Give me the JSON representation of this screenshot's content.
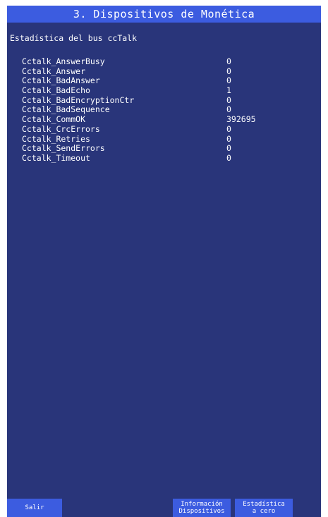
{
  "header": {
    "title": "3. Dispositivos de Monética"
  },
  "section": {
    "heading": "Estadística del bus ccTalk"
  },
  "stats": [
    {
      "name": "Cctalk_AnswerBusy",
      "value": "0"
    },
    {
      "name": "Cctalk_Answer",
      "value": "0"
    },
    {
      "name": "Cctalk_BadAnswer",
      "value": "0"
    },
    {
      "name": "Cctalk_BadEcho",
      "value": "1"
    },
    {
      "name": "Cctalk_BadEncryptionCtr",
      "value": "0"
    },
    {
      "name": "Cctalk_BadSequence",
      "value": "0"
    },
    {
      "name": "Cctalk_CommOK",
      "value": "392695"
    },
    {
      "name": "Cctalk_CrcErrors",
      "value": "0"
    },
    {
      "name": "Cctalk_Retries",
      "value": "0"
    },
    {
      "name": "Cctalk_SendErrors",
      "value": "0"
    },
    {
      "name": "Cctalk_Timeout",
      "value": "0"
    }
  ],
  "buttons": {
    "exit_label": "Salir",
    "info_line1": "Información",
    "info_line2": "Dispositivos",
    "reset_line1": "Estadística",
    "reset_line2": "a cero"
  },
  "colors": {
    "background": "#29357a",
    "accent": "#3c5ce0",
    "text": "#ffffff"
  }
}
